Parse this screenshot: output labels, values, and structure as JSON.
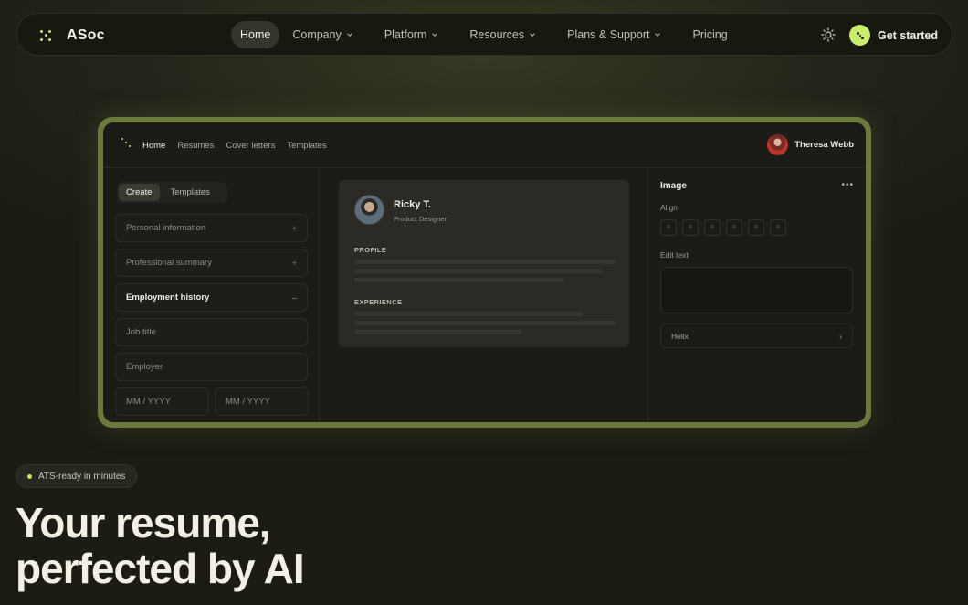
{
  "brand": {
    "name": "ASoc",
    "logo_icon": "dots-logo-icon",
    "accent": "#c6e86a"
  },
  "nav": {
    "items": [
      {
        "label": "Home",
        "active": true,
        "dropdown": false
      },
      {
        "label": "Company",
        "active": false,
        "dropdown": true
      },
      {
        "label": "Platform",
        "active": false,
        "dropdown": true
      },
      {
        "label": "Resources",
        "active": false,
        "dropdown": true
      },
      {
        "label": "Plans & Support",
        "active": false,
        "dropdown": true
      },
      {
        "label": "Pricing",
        "active": false,
        "dropdown": false
      }
    ],
    "theme_icon": "sun-icon",
    "cta_label": "Get started"
  },
  "app": {
    "nav": [
      "Home",
      "Resumes",
      "Cover letters",
      "Templates"
    ],
    "user_name": "Theresa Webb",
    "left": {
      "tabs": [
        "Create",
        "Templates"
      ],
      "sections": [
        {
          "label": "Personal information",
          "mark": "+"
        },
        {
          "label": "Professional summary",
          "mark": "+"
        },
        {
          "label": "Employment history",
          "mark": "–"
        }
      ],
      "placeholders": {
        "job_title": "Job title",
        "employer": "Employer",
        "start_date": "MM / YYYY",
        "end_date": "MM / YYYY"
      }
    },
    "preview": {
      "name": "Ricky T.",
      "role": "Product Designer",
      "profile_label": "PROFILE",
      "experience_label": "EXPERIENCE"
    },
    "right": {
      "title": "Image",
      "more": "•••",
      "align_label": "Align",
      "align_buttons": [
        "≡",
        "≡",
        "≡",
        "≡",
        "≡",
        "≡"
      ],
      "edit_text_label": "Edit text",
      "font_value": "Helix",
      "font_arrow": "›"
    }
  },
  "hero": {
    "badge": "ATS-ready in minutes",
    "line1": "Your resume,",
    "line2": "perfected by AI"
  }
}
